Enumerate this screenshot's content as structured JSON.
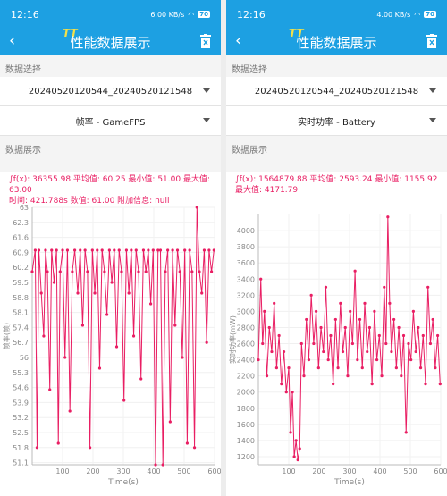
{
  "panes": [
    {
      "status": {
        "time": "12:16",
        "net": "6.00 KB/s",
        "battery": "70"
      },
      "toolbar": {
        "title": "性能数据展示",
        "logo": "TT"
      },
      "data_select_label": "数据选择",
      "file_value": "20240520120544_20240520121548",
      "metric_value": "帧率 - GameFPS",
      "data_display_label": "数据展示",
      "stats_line1": "∫f(x): 36355.98 平均值: 60.25 最小值: 51.00 最大值: 63.00",
      "stats_line2": "时间: 421.788s 数值: 61.00 附加信息: null",
      "chart_data": {
        "type": "line",
        "title": "",
        "xlabel": "Time(s)",
        "ylabel": "帧率(帧)",
        "xlim": [
          0,
          600
        ],
        "ylim": [
          51.0,
          63.0
        ],
        "x_ticks": [
          100,
          200,
          300,
          400,
          500,
          600
        ],
        "y_ticks": [
          "51.1",
          "51.8",
          "52.5",
          "53.2",
          "53.9",
          "54.6",
          "55.3",
          "56",
          "56.7",
          "57.4",
          "58.1",
          "58.8",
          "59.5",
          "60.2",
          "60.9",
          "61.6",
          "62.3",
          "63"
        ],
        "summary": {
          "integral": 36355.98,
          "mean": 60.25,
          "min": 51.0,
          "max": 63.0
        },
        "series": [
          {
            "values": [
              [
                0,
                60
              ],
              [
                10,
                61
              ],
              [
                16,
                51.8
              ],
              [
                22,
                61
              ],
              [
                30,
                59
              ],
              [
                38,
                57
              ],
              [
                44,
                61
              ],
              [
                50,
                60
              ],
              [
                58,
                54.5
              ],
              [
                64,
                61
              ],
              [
                72,
                59.5
              ],
              [
                80,
                61
              ],
              [
                86,
                52
              ],
              [
                92,
                60
              ],
              [
                100,
                61
              ],
              [
                108,
                56
              ],
              [
                116,
                61
              ],
              [
                124,
                53.5
              ],
              [
                132,
                60
              ],
              [
                140,
                61
              ],
              [
                150,
                59
              ],
              [
                158,
                61
              ],
              [
                166,
                57.5
              ],
              [
                174,
                61
              ],
              [
                182,
                60
              ],
              [
                190,
                51.8
              ],
              [
                198,
                61
              ],
              [
                206,
                59
              ],
              [
                214,
                61
              ],
              [
                222,
                55.5
              ],
              [
                230,
                61
              ],
              [
                238,
                60
              ],
              [
                246,
                58
              ],
              [
                254,
                61
              ],
              [
                262,
                59.5
              ],
              [
                270,
                61
              ],
              [
                278,
                56.5
              ],
              [
                286,
                61
              ],
              [
                294,
                60
              ],
              [
                302,
                54
              ],
              [
                310,
                61
              ],
              [
                318,
                59
              ],
              [
                326,
                61
              ],
              [
                334,
                57
              ],
              [
                342,
                61
              ],
              [
                350,
                60
              ],
              [
                358,
                55
              ],
              [
                366,
                61
              ],
              [
                374,
                60
              ],
              [
                382,
                61
              ],
              [
                390,
                58.5
              ],
              [
                398,
                61
              ],
              [
                406,
                51
              ],
              [
                414,
                61
              ],
              [
                422,
                61
              ],
              [
                430,
                51
              ],
              [
                438,
                60
              ],
              [
                446,
                61
              ],
              [
                454,
                53
              ],
              [
                462,
                61
              ],
              [
                470,
                57.5
              ],
              [
                478,
                61
              ],
              [
                486,
                60
              ],
              [
                494,
                56
              ],
              [
                502,
                61
              ],
              [
                510,
                52
              ],
              [
                518,
                61
              ],
              [
                526,
                60
              ],
              [
                534,
                51.8
              ],
              [
                542,
                63
              ],
              [
                550,
                60
              ],
              [
                558,
                59
              ],
              [
                566,
                61
              ],
              [
                574,
                56.7
              ],
              [
                582,
                61
              ],
              [
                590,
                60
              ],
              [
                598,
                61
              ]
            ]
          }
        ]
      }
    },
    {
      "status": {
        "time": "12:16",
        "net": "4.00 KB/s",
        "battery": "70"
      },
      "toolbar": {
        "title": "性能数据展示",
        "logo": "TT"
      },
      "data_select_label": "数据选择",
      "file_value": "20240520120544_20240520121548",
      "metric_value": "实时功率 - Battery",
      "data_display_label": "数据展示",
      "stats_line1": "∫f(x): 1564879.88 平均值: 2593.24 最小值: 1155.92",
      "stats_line2": "最大值: 4171.79",
      "chart_data": {
        "type": "line",
        "title": "",
        "xlabel": "Time(s)",
        "ylabel": "实时功率(mW)",
        "xlim": [
          0,
          600
        ],
        "ylim": [
          1100,
          4200
        ],
        "x_ticks": [
          100,
          200,
          300,
          400,
          500,
          600
        ],
        "y_ticks": [
          "1200",
          "1400",
          "1600",
          "1800",
          "2000",
          "2200",
          "2400",
          "2600",
          "2800",
          "3000",
          "3200",
          "3400",
          "3600",
          "3800",
          "4000"
        ],
        "summary": {
          "integral": 1564879.88,
          "mean": 2593.24,
          "min": 1155.92,
          "max": 4171.79
        },
        "series": [
          {
            "values": [
              [
                0,
                2400
              ],
              [
                8,
                3400
              ],
              [
                14,
                2600
              ],
              [
                20,
                3000
              ],
              [
                28,
                2200
              ],
              [
                36,
                2800
              ],
              [
                44,
                2500
              ],
              [
                52,
                3100
              ],
              [
                60,
                2300
              ],
              [
                68,
                2700
              ],
              [
                76,
                2100
              ],
              [
                84,
                2500
              ],
              [
                92,
                2000
              ],
              [
                100,
                2300
              ],
              [
                106,
                1500
              ],
              [
                112,
                2000
              ],
              [
                118,
                1200
              ],
              [
                124,
                1400
              ],
              [
                130,
                1160
              ],
              [
                136,
                1300
              ],
              [
                142,
                2600
              ],
              [
                150,
                2200
              ],
              [
                158,
                2900
              ],
              [
                166,
                2400
              ],
              [
                174,
                3200
              ],
              [
                182,
                2600
              ],
              [
                190,
                3000
              ],
              [
                198,
                2300
              ],
              [
                206,
                2800
              ],
              [
                214,
                2500
              ],
              [
                222,
                3300
              ],
              [
                230,
                2400
              ],
              [
                238,
                2700
              ],
              [
                246,
                2100
              ],
              [
                254,
                2900
              ],
              [
                262,
                2300
              ],
              [
                270,
                3100
              ],
              [
                278,
                2500
              ],
              [
                286,
                2800
              ],
              [
                294,
                2200
              ],
              [
                302,
                3000
              ],
              [
                310,
                2600
              ],
              [
                318,
                3500
              ],
              [
                326,
                2400
              ],
              [
                334,
                2900
              ],
              [
                342,
                2300
              ],
              [
                350,
                3100
              ],
              [
                358,
                2500
              ],
              [
                366,
                2800
              ],
              [
                374,
                2100
              ],
              [
                382,
                3000
              ],
              [
                390,
                2400
              ],
              [
                398,
                2700
              ],
              [
                406,
                2200
              ],
              [
                414,
                3300
              ],
              [
                420,
                2600
              ],
              [
                426,
                4170
              ],
              [
                432,
                3100
              ],
              [
                438,
                2500
              ],
              [
                446,
                2900
              ],
              [
                454,
                2300
              ],
              [
                462,
                2800
              ],
              [
                470,
                2200
              ],
              [
                478,
                2700
              ],
              [
                486,
                1500
              ],
              [
                494,
                2600
              ],
              [
                502,
                2400
              ],
              [
                510,
                3000
              ],
              [
                518,
                2500
              ],
              [
                526,
                2800
              ],
              [
                534,
                2300
              ],
              [
                542,
                2700
              ],
              [
                550,
                2100
              ],
              [
                558,
                3300
              ],
              [
                566,
                2600
              ],
              [
                574,
                2900
              ],
              [
                582,
                2300
              ],
              [
                590,
                2700
              ],
              [
                598,
                2100
              ]
            ]
          }
        ]
      }
    }
  ]
}
